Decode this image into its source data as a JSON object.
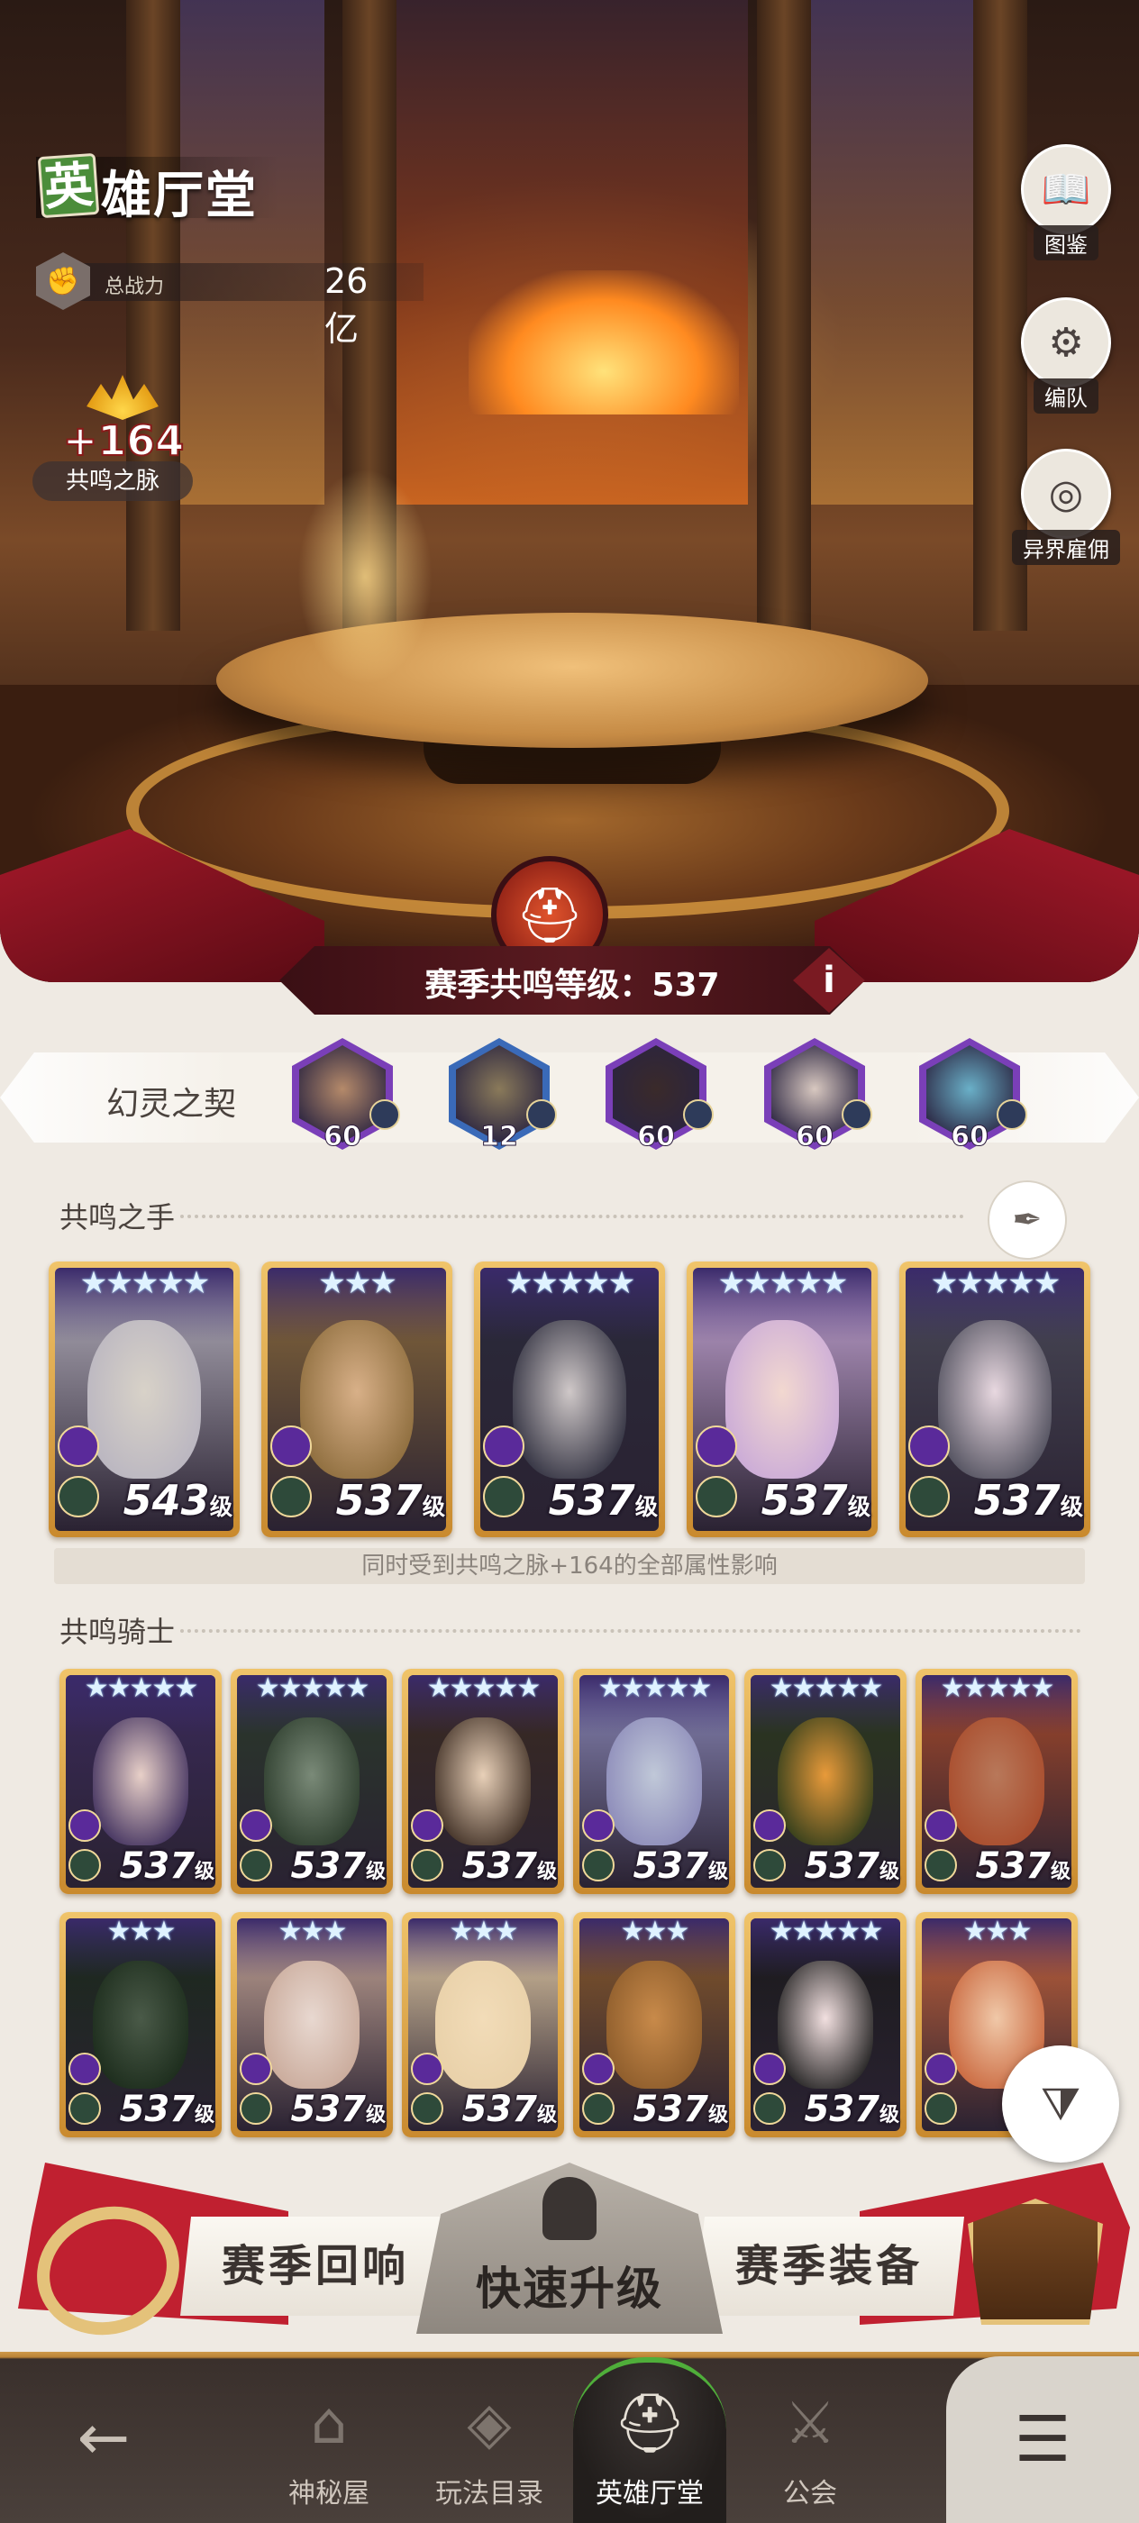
{
  "header": {
    "title_first_char": "英",
    "title_rest": "雄厅堂",
    "power_label": "总战力",
    "power_value": "26亿",
    "resonance_bonus": "+164",
    "resonance_label": "共鸣之脉"
  },
  "side_buttons": [
    {
      "label": "图鉴",
      "icon": "book-icon"
    },
    {
      "label": "编队",
      "icon": "helmet-gear-icon"
    },
    {
      "label": "异界雇佣",
      "icon": "portal-icon"
    }
  ],
  "season": {
    "level_label": "赛季共鸣等级：",
    "level_value": "537",
    "info_glyph": "i"
  },
  "pact": {
    "title": "幻灵之契",
    "avatars": [
      {
        "level": "60",
        "color": "#7a3fb8",
        "skin": "#b58a6a"
      },
      {
        "level": "12",
        "color": "#3a6ab8",
        "skin": "#8a7a5a"
      },
      {
        "level": "60",
        "color": "#7a3fb8",
        "skin": "#3a2a2a"
      },
      {
        "level": "60",
        "color": "#7a3fb8",
        "skin": "#d8c8c0"
      },
      {
        "level": "60",
        "color": "#7a3fb8",
        "skin": "#6ab0c8"
      }
    ]
  },
  "resonating_hands": {
    "title": "共鸣之手",
    "note": "同时受到共鸣之脉+164的全部属性影响",
    "heroes": [
      {
        "stars": "★★★★★",
        "level": "543",
        "level_unit": "级",
        "face": "#d8d2c8",
        "bg": "#b8b4c0"
      },
      {
        "stars": "★★★",
        "level": "537",
        "level_unit": "级",
        "face": "#d8b088",
        "bg": "#8a6a3a"
      },
      {
        "stars": "★★★★★",
        "level": "537",
        "level_unit": "级",
        "face": "#cfc8c8",
        "bg": "#2a2a3a"
      },
      {
        "stars": "★★★★★",
        "level": "537",
        "level_unit": "级",
        "face": "#f2d8d0",
        "bg": "#c8a8d8"
      },
      {
        "stars": "★★★★★",
        "level": "537",
        "level_unit": "级",
        "face": "#e8d8e0",
        "bg": "#4a4a58"
      }
    ]
  },
  "resonating_knights": {
    "title": "共鸣骑士",
    "heroes": [
      {
        "stars": "★★★★★",
        "level": "537",
        "level_unit": "级",
        "face": "#e8d0c8",
        "bg": "#3a2a5a"
      },
      {
        "stars": "★★★★★",
        "level": "537",
        "level_unit": "级",
        "face": "#7a8a78",
        "bg": "#2a3a2a"
      },
      {
        "stars": "★★★★★",
        "level": "537",
        "level_unit": "级",
        "face": "#e8d0b8",
        "bg": "#3a2a20"
      },
      {
        "stars": "★★★★★",
        "level": "537",
        "level_unit": "级",
        "face": "#c0c8d8",
        "bg": "#8a88b8"
      },
      {
        "stars": "★★★★★",
        "level": "537",
        "level_unit": "级",
        "face": "#e89a3a",
        "bg": "#2a3a1a"
      },
      {
        "stars": "★★★★★",
        "level": "537",
        "level_unit": "级",
        "face": "#b8785a",
        "bg": "#a84a2a"
      },
      {
        "stars": "★★★",
        "level": "537",
        "level_unit": "级",
        "face": "#4a5a48",
        "bg": "#1a2a1a"
      },
      {
        "stars": "★★★",
        "level": "537",
        "level_unit": "级",
        "face": "#e8d8d0",
        "bg": "#c8a898"
      },
      {
        "stars": "★★★",
        "level": "537",
        "level_unit": "级",
        "face": "#f2dcb8",
        "bg": "#e8d0a8"
      },
      {
        "stars": "★★★",
        "level": "537",
        "level_unit": "级",
        "face": "#c88a4a",
        "bg": "#8a5a2a"
      },
      {
        "stars": "★★★★★",
        "level": "537",
        "level_unit": "级",
        "face": "#f2e0e0",
        "bg": "#1a1a1a"
      },
      {
        "stars": "★★★",
        "level": "5",
        "level_unit": "",
        "face": "#f0c8a8",
        "bg": "#c8643a"
      }
    ]
  },
  "actions": {
    "left_label": "赛季回响",
    "center_label": "快速升级",
    "right_label": "赛季装备"
  },
  "nav": {
    "back_glyph": "←",
    "items": [
      {
        "label": "神秘屋",
        "icon": "mystery-house-icon"
      },
      {
        "label": "玩法目录",
        "icon": "diamond-grid-icon"
      },
      {
        "label": "英雄厅堂",
        "icon": "helmet-icon"
      },
      {
        "label": "公会",
        "icon": "crossed-swords-icon"
      }
    ],
    "menu_glyph": "☰"
  },
  "colors": {
    "accent_green": "#4fae3a",
    "banner_red": "#7a1a22",
    "card_gold": "#c98a2e",
    "faction_purple": "#7a3fb8"
  }
}
